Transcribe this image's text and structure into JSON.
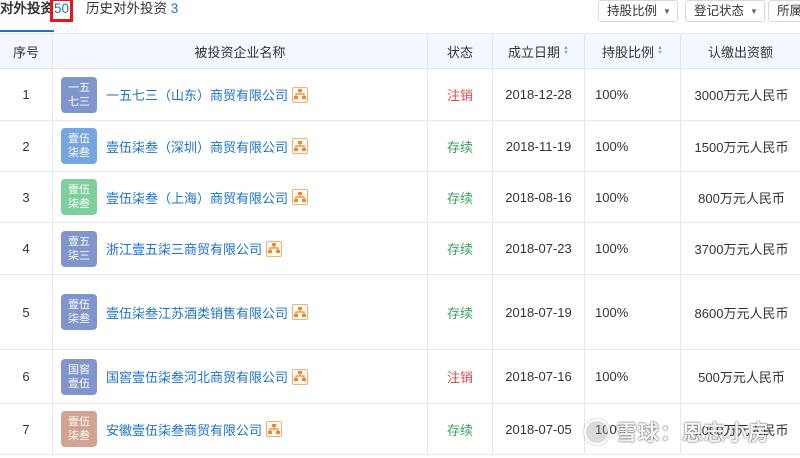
{
  "tabs": {
    "current": {
      "label": "对外投资",
      "count": "50"
    },
    "history": {
      "label": "历史对外投资",
      "count": "3"
    }
  },
  "filters": [
    {
      "label": "持股比例"
    },
    {
      "label": "登记状态"
    },
    {
      "label": "所属"
    }
  ],
  "table": {
    "columns": [
      "序号",
      "被投资企业名称",
      "状态",
      "成立日期",
      "持股比例",
      "认缴出资额"
    ],
    "rows": [
      {
        "index": "1",
        "logo": "一五七三",
        "logo_color": "#7f95cc",
        "name": "一五七三（山东）商贸有限公司",
        "status": "注销",
        "status_type": "cancel",
        "date": "2018-12-28",
        "share": "100%",
        "capital": "3000万元人民币"
      },
      {
        "index": "2",
        "logo": "壹伍柒叁",
        "logo_color": "#77a6de",
        "name": "壹伍柒叁（深圳）商贸有限公司",
        "status": "存续",
        "status_type": "active",
        "date": "2018-11-19",
        "share": "100%",
        "capital": "1500万元人民币"
      },
      {
        "index": "3",
        "logo": "壹伍柒叁",
        "logo_color": "#7fcf9e",
        "name": "壹伍柒叁（上海）商贸有限公司",
        "status": "存续",
        "status_type": "active",
        "date": "2018-08-16",
        "share": "100%",
        "capital": "800万元人民币"
      },
      {
        "index": "4",
        "logo": "壹五柒三",
        "logo_color": "#7f95cc",
        "name": "浙江壹五柒三商贸有限公司",
        "status": "存续",
        "status_type": "active",
        "date": "2018-07-23",
        "share": "100%",
        "capital": "3700万元人民币"
      },
      {
        "index": "5",
        "logo": "壹伍柒叁",
        "logo_color": "#7f95cc",
        "name": "壹伍柒叁江苏酒类销售有限公司",
        "status": "存续",
        "status_type": "active",
        "date": "2018-07-19",
        "share": "100%",
        "capital": "8600万元人民币"
      },
      {
        "index": "6",
        "logo": "国窖壹伍",
        "logo_color": "#7f95cc",
        "name": "国窖壹伍柒叁河北商贸有限公司",
        "status": "注销",
        "status_type": "cancel",
        "date": "2018-07-16",
        "share": "100%",
        "capital": "500万元人民币"
      },
      {
        "index": "7",
        "logo": "壹伍柒叁",
        "logo_color": "#d2a392",
        "name": "安徽壹伍柒叁商贸有限公司",
        "status": "存续",
        "status_type": "active",
        "date": "2018-07-05",
        "share": "100%",
        "capital": "1000万元人民币"
      }
    ]
  },
  "colors": {
    "link": "#1a73c9",
    "cancel": "#e04a4a",
    "active": "#3aa05c",
    "header_bg": "#f2f8fe",
    "highlight_box": "#e8141b"
  },
  "watermark": {
    "text": "雪球：恩志小房"
  }
}
